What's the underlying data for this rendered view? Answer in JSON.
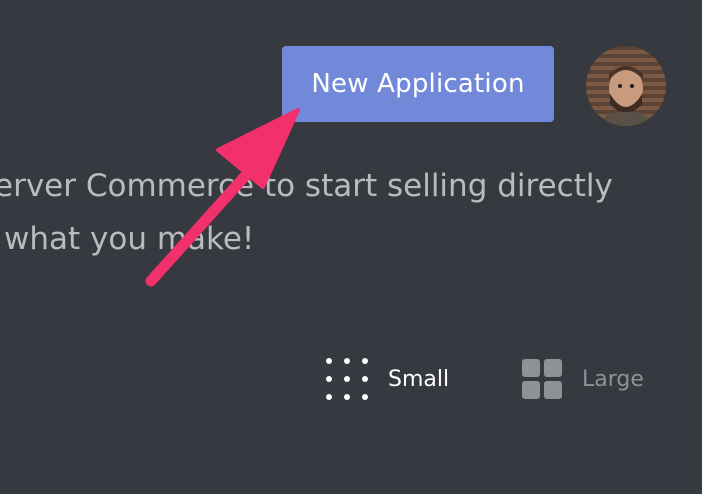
{
  "header": {
    "new_application_label": "New Application",
    "avatar_label": "user-avatar"
  },
  "description": {
    "line1": "erver Commerce to start selling directly",
    "line2": "what you make!"
  },
  "view_toggle": {
    "small_label": "Small",
    "large_label": "Large",
    "selected": "Small"
  },
  "annotation": {
    "arrow_icon": "pink-arrow-icon",
    "arrow_color": "#f2306c"
  },
  "colors": {
    "background": "#36393f",
    "button": "#7289da",
    "text_active": "#ffffff",
    "text_muted": "#b9bbbe",
    "icon_inactive": "#8e9297"
  }
}
